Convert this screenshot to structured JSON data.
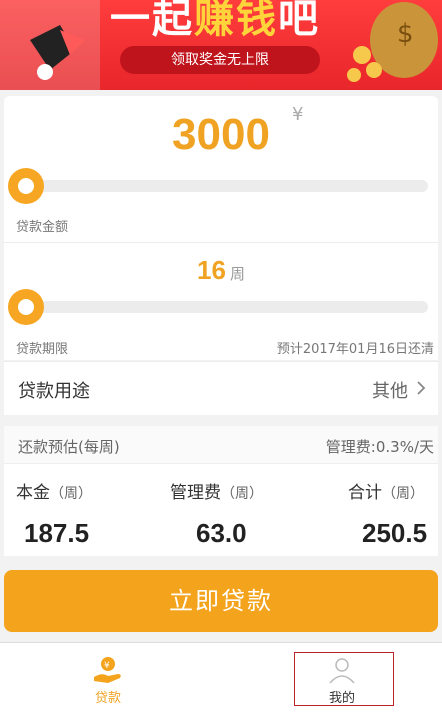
{
  "banner": {
    "title_prefix": "一起",
    "title_highlight": "赚钱",
    "title_suffix": "吧",
    "pill_text": "领取奖金无上限"
  },
  "amount": {
    "value": "3000",
    "unit": "¥",
    "label": "贷款金额",
    "slider_fraction": 0.0
  },
  "term": {
    "value": "16",
    "unit": "周",
    "label": "贷款期限",
    "due_note": "预计2017年01月16日还清",
    "slider_fraction": 0.0
  },
  "purpose": {
    "label": "贷款用途",
    "value": "其他"
  },
  "estimate": {
    "title": "还款预估(每周)",
    "fee_note": "管理费:0.3%/天",
    "columns": [
      {
        "name": "本金",
        "unit": "（周）",
        "value": "187.5"
      },
      {
        "name": "管理费",
        "unit": "（周）",
        "value": "63.0"
      },
      {
        "name": "合计",
        "unit": "（周）",
        "value": "250.5"
      }
    ]
  },
  "apply_button": "立即贷款",
  "tabs": [
    {
      "label": "贷款",
      "icon": "loan-icon",
      "active": true
    },
    {
      "label": "我的",
      "icon": "user-icon",
      "active": false
    }
  ],
  "colors": {
    "accent": "#f4a31d",
    "banner_red": "#e8262b",
    "highlight_yellow": "#ffd43a"
  }
}
